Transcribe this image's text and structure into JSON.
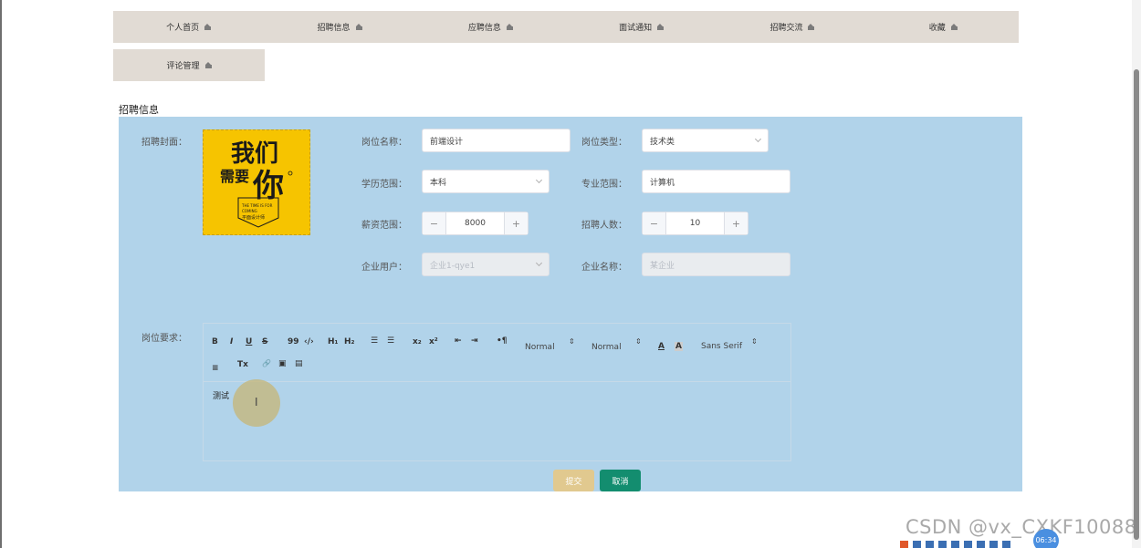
{
  "nav": {
    "items": [
      "个人首页",
      "招聘信息",
      "应聘信息",
      "面试通知",
      "招聘交流",
      "收藏"
    ],
    "row2": [
      "评论管理"
    ]
  },
  "section_title": "招聘信息",
  "form": {
    "cover_label": "招聘封面：",
    "cover_image": {
      "alt_lines": [
        "我们",
        "需要",
        "你",
        "THE TIME IS FOR",
        "COMING",
        "平面设计师"
      ],
      "bg_color": "#f6c400"
    },
    "job_name": {
      "label": "岗位名称：",
      "value": "前端设计"
    },
    "job_type": {
      "label": "岗位类型：",
      "value": "技术类"
    },
    "education": {
      "label": "学历范围：",
      "value": "本科"
    },
    "major": {
      "label": "专业范围：",
      "value": "计算机"
    },
    "salary": {
      "label": "薪资范围：",
      "value": "8000"
    },
    "headcount": {
      "label": "招聘人数：",
      "value": "10"
    },
    "company_user": {
      "label": "企业用户：",
      "placeholder": "企业1-qye1"
    },
    "company_name": {
      "label": "企业名称：",
      "placeholder": "某企业"
    },
    "requirements": {
      "label": "岗位要求：",
      "content": "测试",
      "toolbar": {
        "bold": "B",
        "italic": "I",
        "underline": "U",
        "strike": "S",
        "quote": "99",
        "code": "‹/›",
        "h1": "H₁",
        "h2": "H₂",
        "ol": "☰",
        "ul": "☰",
        "sub": "x₂",
        "sup": "x²",
        "outdent": "⇤",
        "indent": "⇥",
        "direction": "•¶",
        "size_select": "Normal",
        "header_select": "Normal",
        "color": "A",
        "background": "A",
        "font_select": "Sans Serif",
        "align": "≡",
        "clean": "Tx",
        "link": "🔗",
        "image": "▣",
        "video": "▤"
      }
    },
    "submit_label": "提交",
    "cancel_label": "取消"
  },
  "watermark": "CSDN @vx_CXKF10088",
  "clock": "06:34",
  "colors": {
    "nav_bg": "#e1dbd4",
    "panel_bg": "#b1d3ea",
    "submit_bg": "#e1c98f",
    "cancel_bg": "#138d6f"
  }
}
